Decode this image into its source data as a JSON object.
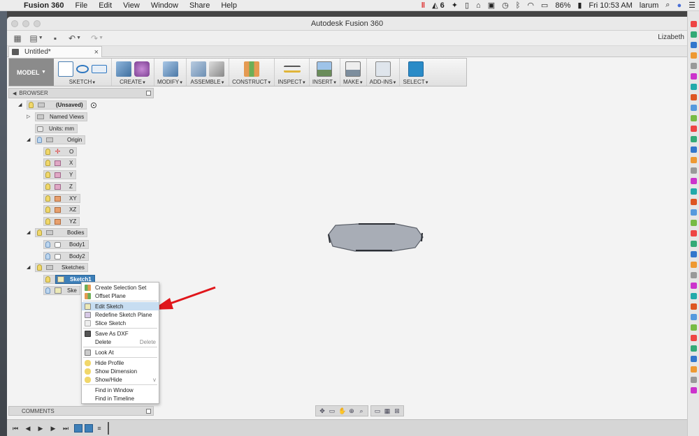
{
  "menubar": {
    "app": "Fusion 360",
    "items": [
      "File",
      "Edit",
      "View",
      "Window",
      "Share",
      "Help"
    ],
    "tray_badge": "6",
    "battery": "86%",
    "clock": "Fri 10:53 AM",
    "user": "larum"
  },
  "window": {
    "title": "Autodesk Fusion 360",
    "user_short": "Lizabeth"
  },
  "document_tab": {
    "title": "Untitled*",
    "close": "×"
  },
  "ribbon": {
    "workspace": "MODEL",
    "groups": [
      {
        "label": "SKETCH"
      },
      {
        "label": "CREATE"
      },
      {
        "label": "MODIFY"
      },
      {
        "label": "ASSEMBLE"
      },
      {
        "label": "CONSTRUCT"
      },
      {
        "label": "INSPECT"
      },
      {
        "label": "INSERT"
      },
      {
        "label": "MAKE"
      },
      {
        "label": "ADD-INS"
      },
      {
        "label": "SELECT"
      }
    ]
  },
  "browser": {
    "title": "BROWSER",
    "root": "(Unsaved)",
    "named_views": "Named Views",
    "units": "Units: mm",
    "origin": "Origin",
    "origin_items": [
      "O",
      "X",
      "Y",
      "Z",
      "XY",
      "XZ",
      "YZ"
    ],
    "bodies": "Bodies",
    "body_items": [
      "Body1",
      "Body2"
    ],
    "sketches": "Sketches",
    "sketch_items": [
      "Sketch1",
      "Ske"
    ]
  },
  "context_menu": {
    "items": [
      {
        "label": "Create Selection Set",
        "shortcut": ""
      },
      {
        "label": "Offset Plane",
        "shortcut": ""
      },
      {
        "label": "Edit Sketch",
        "shortcut": ""
      },
      {
        "label": "Redefine Sketch Plane",
        "shortcut": ""
      },
      {
        "label": "Slice Sketch",
        "shortcut": ""
      },
      {
        "label": "Save As DXF",
        "shortcut": ""
      },
      {
        "label": "Delete",
        "shortcut": "Delete"
      },
      {
        "label": "Look At",
        "shortcut": ""
      },
      {
        "label": "Hide Profile",
        "shortcut": ""
      },
      {
        "label": "Show Dimension",
        "shortcut": ""
      },
      {
        "label": "Show/Hide",
        "shortcut": "v"
      },
      {
        "label": "Find in Window",
        "shortcut": ""
      },
      {
        "label": "Find in Timeline",
        "shortcut": ""
      }
    ],
    "highlighted": "Edit Sketch"
  },
  "comments": {
    "title": "COMMENTS"
  },
  "colors": {
    "accent": "#3d7fb8",
    "highlight": "#c7ddf1",
    "arrow": "#e0161b",
    "body_fill": "#a8adb6"
  },
  "icons": {
    "timeline": [
      "skip-start-icon",
      "step-back-icon",
      "play-icon",
      "step-forward-icon",
      "skip-end-icon"
    ],
    "navbar": [
      "orbit-icon",
      "look-at-icon",
      "pan-icon",
      "zoom-icon",
      "fit-icon",
      "display-settings-icon",
      "grid-settings-icon",
      "viewports-icon"
    ]
  }
}
